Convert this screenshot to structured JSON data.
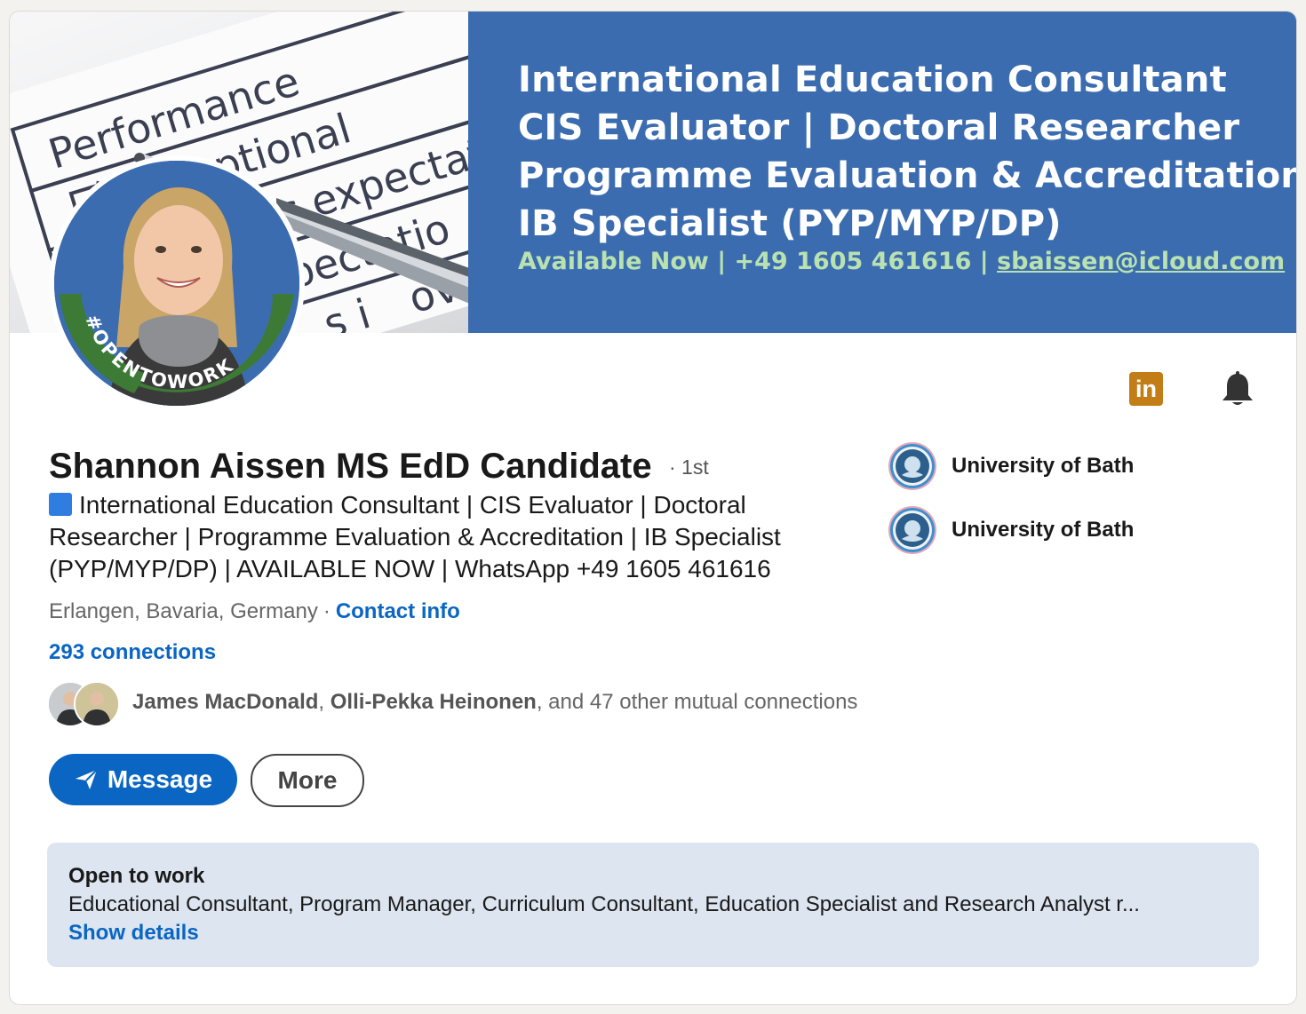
{
  "banner": {
    "photo_text": {
      "performance": "Performance",
      "exceptional": "Exceptional",
      "exceeds": "xceeds expectati",
      "expectations": "xpectatio",
      "improve": "ove",
      "needs": "s i"
    },
    "lines": [
      "International Education Consultant",
      "CIS Evaluator | Doctoral Researcher",
      "Programme Evaluation & Accreditation",
      "IB Specialist (PYP/MYP/DP)"
    ],
    "contact_prefix": "Available Now | +49 1605 461616 | ",
    "contact_email": "sbaissen@icloud.com",
    "colors": {
      "blue": "#3b6cb0",
      "green_text": "#b9e2b0"
    }
  },
  "avatar": {
    "badge_text": "#OPENTOWORK",
    "badge_color": "#3c7a35"
  },
  "icons": {
    "linkedin": "in",
    "bell": "bell-icon"
  },
  "profile": {
    "name": "Shannon Aissen MS EdD Candidate",
    "degree": "· 1st",
    "headline": "International Education Consultant | CIS Evaluator | Doctoral Researcher | Programme Evaluation & Accreditation | IB Specialist (PYP/MYP/DP) | AVAILABLE NOW | WhatsApp +49 1605 461616",
    "location": "Erlangen, Bavaria, Germany",
    "separator": "·",
    "contact_info": "Contact info",
    "connections": "293 connections"
  },
  "mutual": {
    "name1": "James MacDonald",
    "comma": ", ",
    "name2": "Olli-Pekka Heinonen",
    "rest": ", and 47 other mutual connections"
  },
  "actions": {
    "message": "Message",
    "more": "More"
  },
  "education": [
    {
      "name": "University of Bath"
    },
    {
      "name": "University of Bath"
    }
  ],
  "open_to_work": {
    "title": "Open to work",
    "roles": "Educational Consultant, Program Manager, Curriculum Consultant, Education Specialist and Research Analyst r...",
    "link": "Show details"
  },
  "colors": {
    "link_blue": "#0a66c2",
    "panel": "#dde5f0",
    "page_bg": "#f4f2ee"
  }
}
